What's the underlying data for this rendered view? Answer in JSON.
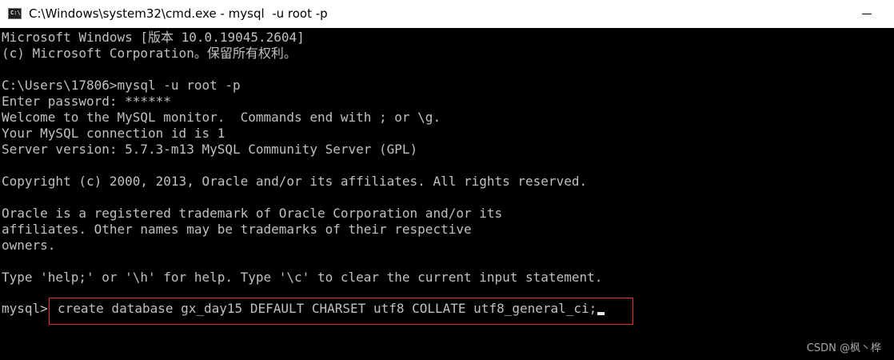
{
  "window": {
    "title": "C:\\Windows\\system32\\cmd.exe - mysql  -u root -p",
    "icon_label": "C:\\",
    "minimize_icon": "minimize-icon"
  },
  "console": {
    "lines": [
      "Microsoft Windows [版本 10.0.19045.2604]",
      "(c) Microsoft Corporation。保留所有权利。",
      "",
      "C:\\Users\\17806>mysql -u root -p",
      "Enter password: ******",
      "Welcome to the MySQL monitor.  Commands end with ; or \\g.",
      "Your MySQL connection id is 1",
      "Server version: 5.7.3-m13 MySQL Community Server (GPL)",
      "",
      "Copyright (c) 2000, 2013, Oracle and/or its affiliates. All rights reserved.",
      "",
      "Oracle is a registered trademark of Oracle Corporation and/or its",
      "affiliates. Other names may be trademarks of their respective",
      "owners.",
      "",
      "Type 'help;' or '\\h' for help. Type '\\c' to clear the current input statement."
    ],
    "prompt": "mysql>",
    "command": "create database gx_day15 DEFAULT CHARSET utf8 COLLATE utf8_general_ci;"
  },
  "colors": {
    "console_bg": "#000000",
    "console_fg": "#c0c0c0",
    "highlight_border": "#e8322e"
  },
  "watermark": "CSDN @枫丶桦"
}
